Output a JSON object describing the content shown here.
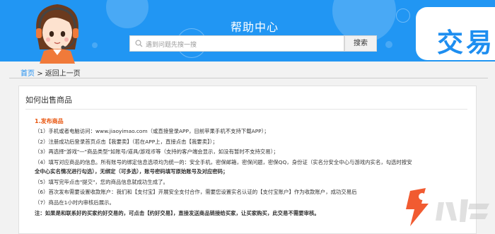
{
  "header": {
    "title": "帮助中心",
    "search_placeholder": "遇到问题先搜一搜",
    "search_button": "搜索",
    "trade_label": "交易",
    "brand_color": "#2196f3"
  },
  "breadcrumb": {
    "home": "首页",
    "separator": ">",
    "back": "返回上一页"
  },
  "article": {
    "title": "如何出售商品",
    "section": "1.发布商品",
    "steps": [
      "（1）手机或者电脑访问：www.jiaoyimao.com（或直接登录APP，目前苹果手机不支持下载APP）；",
      "（2）注册成功后登录首页点击【我要卖】（若在APP上，直接点击【我要卖】）；",
      "（3）再选择\"游戏\"—\"商品类型\"如账号/道具/游戏币等（支持的客户端会显示，如没有暂时不支持交易）；",
      "（4）填写对应商品的信息。所有账号的绑定信息选项均为统一的：安全手机，密保邮箱，密保问题，密保QQ，身份证（实名分安全中心与游戏内实名，勾选时按安",
      "全中心实名情况进行勾选），无绑定（可多选），账号密码填写原始账号及对应密码；",
      "（5）填写完毕点击\"提交\"，您的商品信息就成功生成了。",
      "（6）首次发布需要设置收款账户：我们和【支付宝】开展安全支付合作，需要您设置实名认证的【支付宝账户】作为收款账户，成功交易后",
      "（7）商品在1小时内审核后展示。"
    ],
    "note": "注：如果是和联系好的买家约好交易的，可点击【约好交易】，直接发送商品链接给买家，让买家购买，此交易不需要审核。",
    "accent_color": "#e8540d"
  },
  "watermark": {
    "logo_icon": "nine-game-logo-icon",
    "fragment": "款。"
  }
}
